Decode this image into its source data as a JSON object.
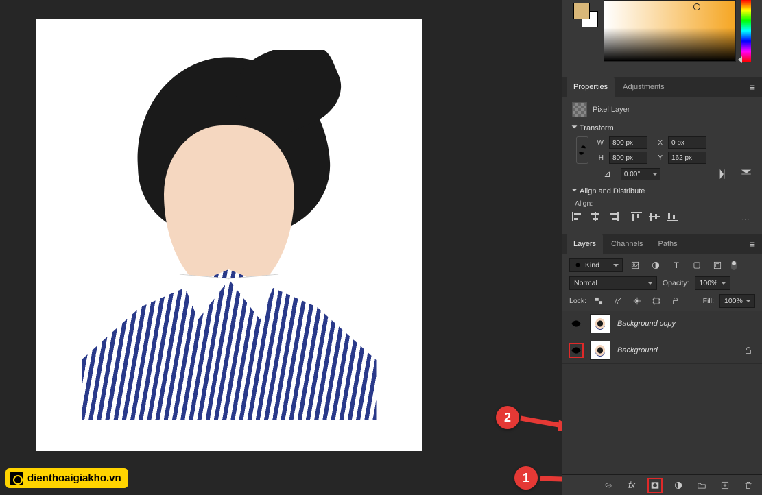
{
  "watermark": "dienthoaigiakho.vn",
  "annotations": {
    "b1": "1",
    "b2": "2"
  },
  "properties": {
    "tabs": {
      "properties": "Properties",
      "adjustments": "Adjustments"
    },
    "layer_type": "Pixel Layer",
    "transform": {
      "title": "Transform",
      "w_label": "W",
      "w": "800 px",
      "h_label": "H",
      "h": "800 px",
      "x_label": "X",
      "x": "0 px",
      "y_label": "Y",
      "y": "162 px",
      "angle": "0.00°"
    },
    "align": {
      "title": "Align and Distribute",
      "label": "Align:"
    }
  },
  "layers_panel": {
    "tabs": {
      "layers": "Layers",
      "channels": "Channels",
      "paths": "Paths"
    },
    "filter": {
      "kind_label": "Kind",
      "search_icon": "search"
    },
    "blend": {
      "mode": "Normal",
      "opacity_label": "Opacity:",
      "opacity": "100%"
    },
    "lock": {
      "label": "Lock:",
      "fill_label": "Fill:",
      "fill": "100%"
    },
    "layers": [
      {
        "name": "Background copy",
        "locked": false
      },
      {
        "name": "Background",
        "locked": true
      }
    ]
  }
}
